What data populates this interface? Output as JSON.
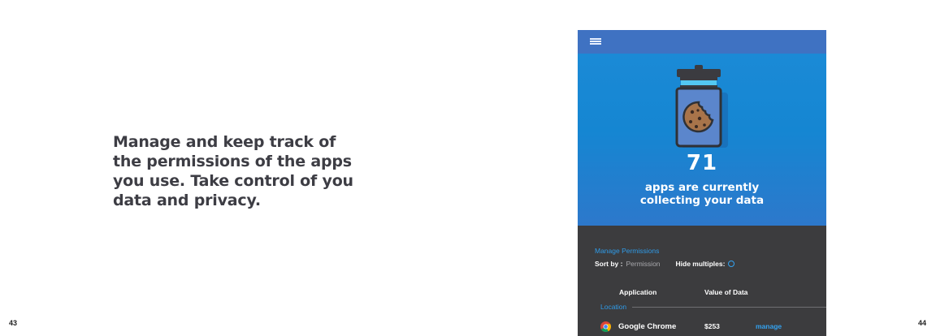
{
  "headline": "Manage and keep track of the permissions of the apps you use. Take control of you data and privacy.",
  "page_numbers": {
    "left": "43",
    "right": "44"
  },
  "app": {
    "hero": {
      "count": "71",
      "tagline_line1": "apps are currently",
      "tagline_line2": "collecting your data"
    },
    "panel": {
      "section_title": "Manage Permissions",
      "sort_label": "Sort by :",
      "sort_value": "Permission",
      "hide_label": "Hide multiples:",
      "columns": {
        "application": "Application",
        "value": "Value of Data"
      },
      "group": "Location",
      "rows": [
        {
          "name": "Google Chrome",
          "value": "$253",
          "action": "manage"
        }
      ]
    }
  },
  "colors": {
    "topbar": "#3f72c2",
    "hero": "#1586d2",
    "panel": "#3c3c3e",
    "accent": "#2f9be8"
  },
  "icons": [
    "menu-icon",
    "cookie-jar-icon",
    "chrome-icon"
  ]
}
